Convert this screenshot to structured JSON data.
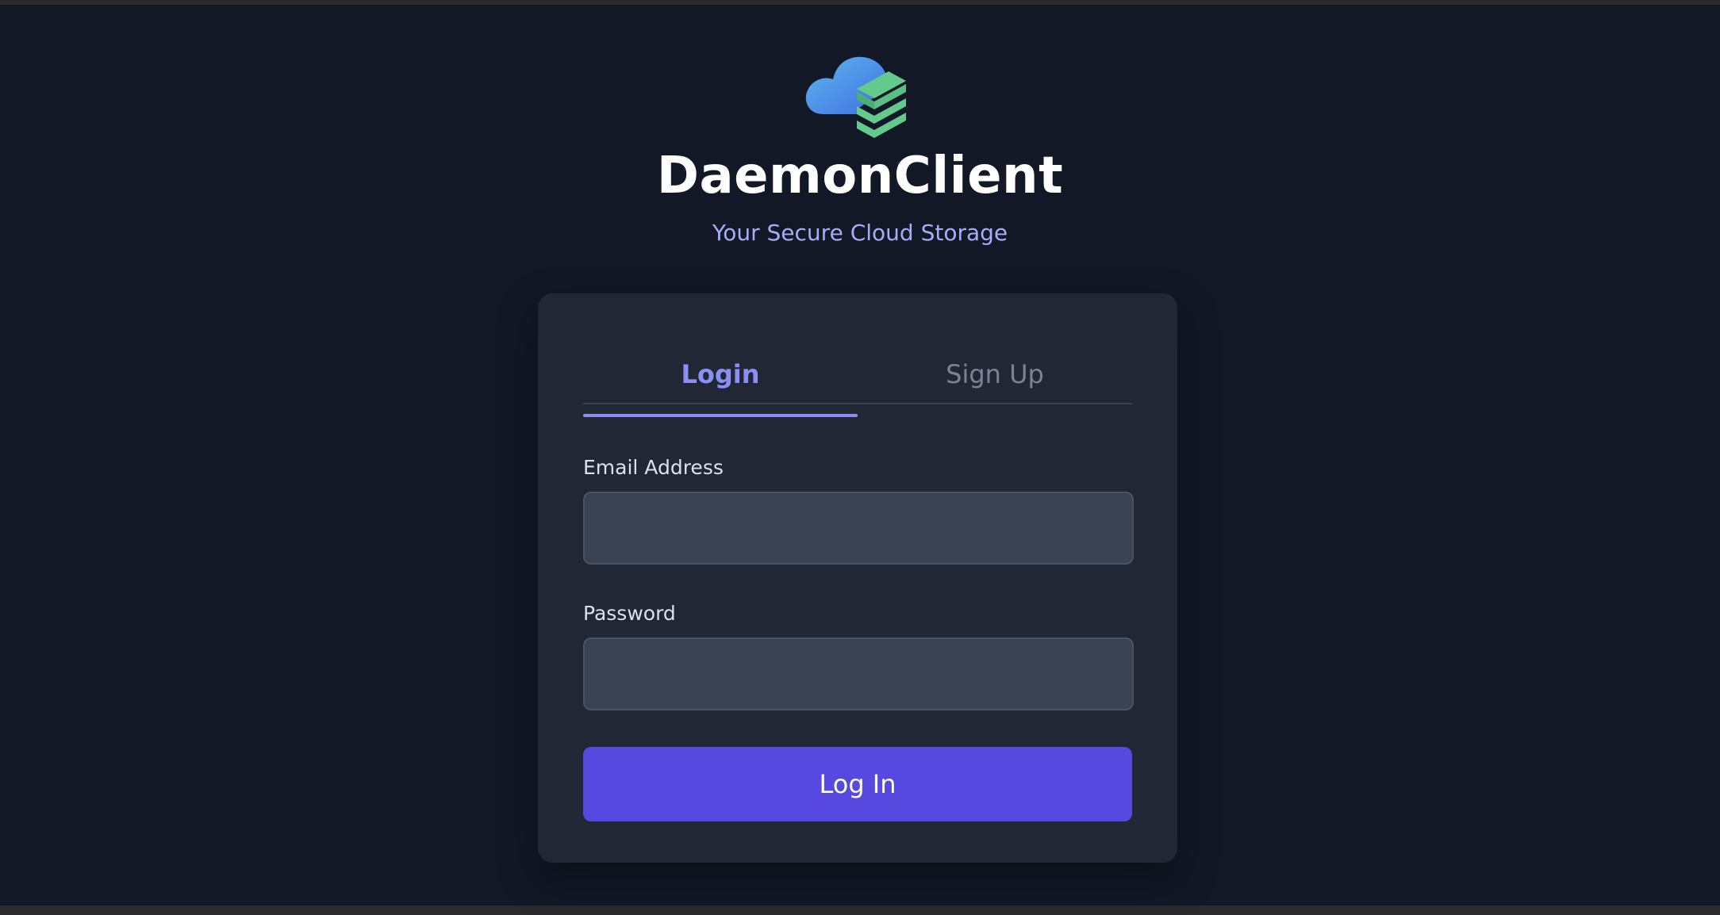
{
  "app": {
    "name": "DaemonClient",
    "tagline": "Your Secure Cloud Storage",
    "logo_icon": "cloud-storage-stack-icon"
  },
  "auth": {
    "tabs": [
      {
        "label": "Login",
        "active": true
      },
      {
        "label": "Sign Up",
        "active": false
      }
    ],
    "email_label": "Email Address",
    "email_value": "",
    "password_label": "Password",
    "password_value": "",
    "submit_label": "Log In"
  },
  "colors": {
    "background": "#131826",
    "card": "#212735",
    "accent": "#8b8ff5",
    "button": "#5748df",
    "input": "#3b4252",
    "logo_blue": "#4f9de8",
    "logo_green": "#63c98c"
  }
}
